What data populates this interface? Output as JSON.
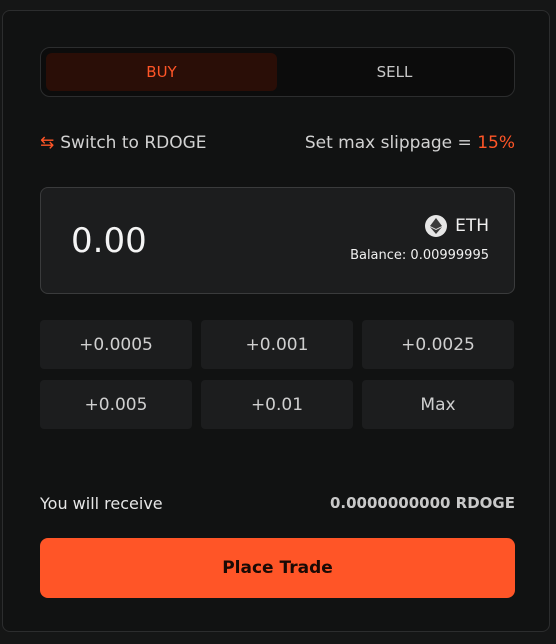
{
  "tabs": {
    "buy": "BUY",
    "sell": "SELL",
    "active": "BUY"
  },
  "switch": {
    "icon": "swap-arrows-icon",
    "label": "Switch to RDOGE"
  },
  "slippage": {
    "label": "Set max slippage =",
    "value": "15%"
  },
  "amount": {
    "placeholder": "0.00",
    "token": "ETH",
    "token_icon": "ethereum-icon",
    "balance": "Balance: 0.00999995"
  },
  "quick_amounts": [
    "+0.0005",
    "+0.001",
    "+0.0025",
    "+0.005",
    "+0.01",
    "Max"
  ],
  "receive": {
    "label": "You will receive",
    "value": "0.0000000000 RDOGE"
  },
  "action": {
    "label": "Place Trade"
  },
  "colors": {
    "accent": "#ff5527",
    "background": "#111212",
    "input_bg": "#1c1d1e",
    "buy_tab_bg": "#2a0e07"
  }
}
